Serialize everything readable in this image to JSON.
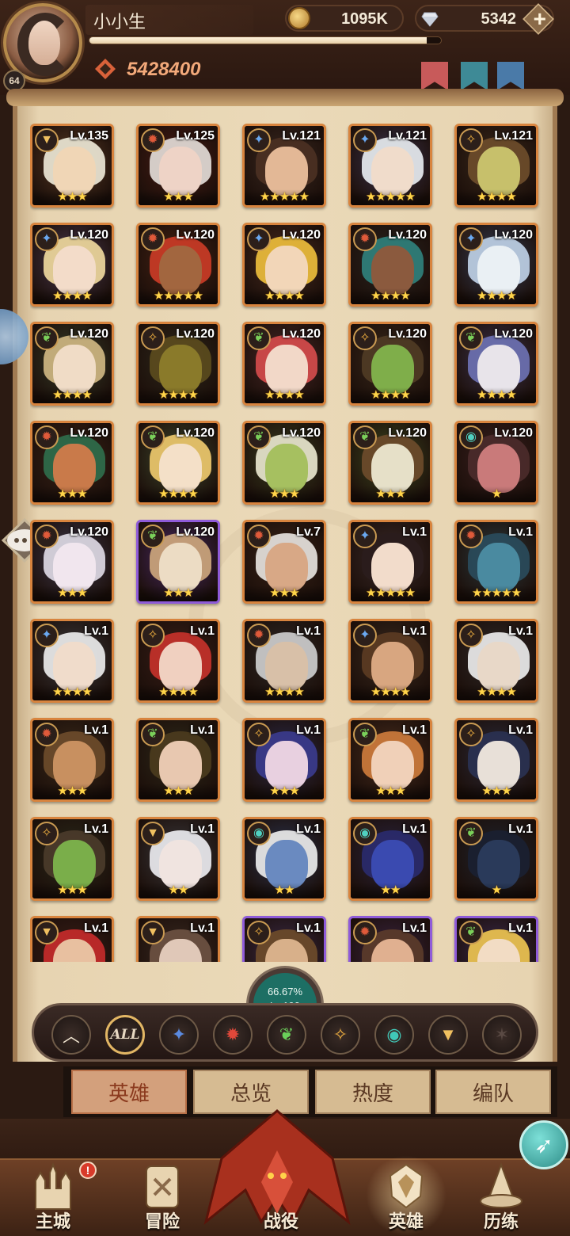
{
  "player": {
    "name": "小小生",
    "level": "64",
    "power": "5428400",
    "xp_progress": 0.96
  },
  "currencies": {
    "gold": "1095K",
    "gems": "5342",
    "gold_icon": "gold-coin-icon",
    "gem_icon": "diamond-icon",
    "plus_icon": "plus-icon"
  },
  "heroes": [
    {
      "level": "Lv.135",
      "faction": "lightbearer",
      "stars": 3,
      "frame": "orange",
      "skin": "#f0d6b6",
      "hair": "#e7e2d0",
      "bg": "#5a3b24"
    },
    {
      "level": "Lv.125",
      "faction": "maulers",
      "stars": 3,
      "frame": "orange",
      "skin": "#eed3c6",
      "hair": "#ddd6d2",
      "bg": "#4a1c14"
    },
    {
      "level": "Lv.121",
      "faction": "wilder_blue",
      "stars": 5,
      "frame": "orange",
      "skin": "#e3b896",
      "hair": "#4a2f22",
      "bg": "#3b2a22"
    },
    {
      "level": "Lv.121",
      "faction": "wilder_blue",
      "stars": 5,
      "frame": "orange",
      "skin": "#f0dccb",
      "hair": "#e2e6ea",
      "bg": "#3c3550"
    },
    {
      "level": "Lv.121",
      "faction": "graveborn_gold",
      "stars": 4,
      "frame": "orange",
      "skin": "#c7c06b",
      "hair": "#6a4b2a",
      "bg": "#3a2a1c"
    },
    {
      "level": "Lv.120",
      "faction": "wilder_blue",
      "stars": 4,
      "frame": "orange",
      "skin": "#f3dcc9",
      "hair": "#e9d39a",
      "bg": "#4a3a52"
    },
    {
      "level": "Lv.120",
      "faction": "maulers",
      "stars": 5,
      "frame": "orange",
      "skin": "#a2663f",
      "hair": "#c53a26",
      "bg": "#4a2414"
    },
    {
      "level": "Lv.120",
      "faction": "wilder_blue",
      "stars": 4,
      "frame": "orange",
      "skin": "#f2d6b8",
      "hair": "#e7b83a",
      "bg": "#4a2c20"
    },
    {
      "level": "Lv.120",
      "faction": "maulers",
      "stars": 4,
      "frame": "orange",
      "skin": "#8b5a3e",
      "hair": "#2f7d78",
      "bg": "#2a2622"
    },
    {
      "level": "Lv.120",
      "faction": "wilder_blue",
      "stars": 4,
      "frame": "orange",
      "skin": "#eaf0f4",
      "hair": "#b9cbe0",
      "bg": "#36405a"
    },
    {
      "level": "Lv.120",
      "faction": "wilder_green",
      "stars": 4,
      "frame": "orange",
      "skin": "#f0dcc6",
      "hair": "#c9b27e",
      "bg": "#36402a"
    },
    {
      "level": "Lv.120",
      "faction": "graveborn_gold",
      "stars": 4,
      "frame": "orange",
      "skin": "#8a7a2a",
      "hair": "#5a4a1e",
      "bg": "#2e2a1c"
    },
    {
      "level": "Lv.120",
      "faction": "wilder_green",
      "stars": 4,
      "frame": "orange",
      "skin": "#f2d8c8",
      "hair": "#d04a4a",
      "bg": "#4a2828"
    },
    {
      "level": "Lv.120",
      "faction": "graveborn_gold",
      "stars": 4,
      "frame": "orange",
      "skin": "#7fae4a",
      "hair": "#4e3a24",
      "bg": "#3a2a1c"
    },
    {
      "level": "Lv.120",
      "faction": "wilder_green",
      "stars": 4,
      "frame": "orange",
      "skin": "#e8e4ea",
      "hair": "#6a6fae",
      "bg": "#3c3450"
    },
    {
      "level": "Lv.120",
      "faction": "maulers",
      "stars": 3,
      "frame": "orange",
      "skin": "#c97a4a",
      "hair": "#2e6a4a",
      "bg": "#3a2418"
    },
    {
      "level": "Lv.120",
      "faction": "wilder_green",
      "stars": 4,
      "frame": "orange",
      "skin": "#f4e0c8",
      "hair": "#e8c46a",
      "bg": "#3e4a2e"
    },
    {
      "level": "Lv.120",
      "faction": "wilder_green",
      "stars": 3,
      "frame": "orange",
      "skin": "#a6c060",
      "hair": "#e3e0c8",
      "bg": "#3a4220"
    },
    {
      "level": "Lv.120",
      "faction": "wilder_green",
      "stars": 3,
      "frame": "orange",
      "skin": "#e6e0c8",
      "hair": "#6a4a2a",
      "bg": "#3e4a20"
    },
    {
      "level": "Lv.120",
      "faction": "dimensional",
      "stars": 1,
      "frame": "orange",
      "skin": "#c97a7a",
      "hair": "#4a2a2a",
      "bg": "#3a2020"
    },
    {
      "level": "Lv.120",
      "faction": "maulers",
      "stars": 3,
      "frame": "orange",
      "skin": "#f1e6ee",
      "hair": "#d8d4de",
      "bg": "#3e3a50"
    },
    {
      "level": "Lv.120",
      "faction": "wilder_green",
      "stars": 3,
      "frame": "purple",
      "skin": "#ecdcc4",
      "hair": "#c8a27a",
      "bg": "#4a2a6a"
    },
    {
      "level": "Lv.7",
      "faction": "maulers",
      "stars": 3,
      "frame": "orange",
      "skin": "#d8a886",
      "hair": "#e0dcd8",
      "bg": "#3a2418"
    },
    {
      "level": "Lv.1",
      "faction": "wilder_blue",
      "stars": 5,
      "frame": "orange",
      "skin": "#f2dccb",
      "hair": "#2a1c1c",
      "bg": "#3a2a2a"
    },
    {
      "level": "Lv.1",
      "faction": "maulers",
      "stars": 5,
      "frame": "orange",
      "skin": "#4a8aa0",
      "hair": "#2a4a5a",
      "bg": "#2a3a3e"
    },
    {
      "level": "Lv.1",
      "faction": "wilder_blue",
      "stars": 4,
      "frame": "orange",
      "skin": "#f0dccb",
      "hair": "#e6e6e6",
      "bg": "#3a3a3e"
    },
    {
      "level": "Lv.1",
      "faction": "graveborn_gold",
      "stars": 4,
      "frame": "orange",
      "skin": "#f0d0c0",
      "hair": "#c0302a",
      "bg": "#3a1e18"
    },
    {
      "level": "Lv.1",
      "faction": "maulers",
      "stars": 4,
      "frame": "orange",
      "skin": "#d8c0a8",
      "hair": "#c8c8c8",
      "bg": "#2e2a28"
    },
    {
      "level": "Lv.1",
      "faction": "wilder_blue",
      "stars": 4,
      "frame": "orange",
      "skin": "#d8a680",
      "hair": "#5a3a22",
      "bg": "#3a2a1e"
    },
    {
      "level": "Lv.1",
      "faction": "graveborn_gold",
      "stars": 4,
      "frame": "orange",
      "skin": "#e8d8c8",
      "hair": "#e6e6e6",
      "bg": "#2e2a2a"
    },
    {
      "level": "Lv.1",
      "faction": "maulers",
      "stars": 3,
      "frame": "orange",
      "skin": "#c89060",
      "hair": "#6a4a2a",
      "bg": "#3a2a1a"
    },
    {
      "level": "Lv.1",
      "faction": "wilder_green",
      "stars": 3,
      "frame": "orange",
      "skin": "#e8c8b0",
      "hair": "#4a3a1e",
      "bg": "#2e2a1a"
    },
    {
      "level": "Lv.1",
      "faction": "graveborn_gold",
      "stars": 3,
      "frame": "orange",
      "skin": "#e8d0e0",
      "hair": "#3a3a8a",
      "bg": "#2a2a4a"
    },
    {
      "level": "Lv.1",
      "faction": "wilder_green",
      "stars": 3,
      "frame": "orange",
      "skin": "#f0d0b8",
      "hair": "#c8783a",
      "bg": "#4a2e1e"
    },
    {
      "level": "Lv.1",
      "faction": "graveborn_gold",
      "stars": 3,
      "frame": "orange",
      "skin": "#e8e0d8",
      "hair": "#2a3050",
      "bg": "#2a2a3a"
    },
    {
      "level": "Lv.1",
      "faction": "graveborn_gold",
      "stars": 3,
      "frame": "orange",
      "skin": "#7aae4a",
      "hair": "#4a3a2a",
      "bg": "#2a2a1a"
    },
    {
      "level": "Lv.1",
      "faction": "lightbearer",
      "stars": 2,
      "frame": "orange",
      "skin": "#f0e4e0",
      "hair": "#e6e6ea",
      "bg": "#3a3a3e"
    },
    {
      "level": "Lv.1",
      "faction": "dimensional",
      "stars": 2,
      "frame": "orange",
      "skin": "#6a8ac0",
      "hair": "#e6e6e6",
      "bg": "#2a3450"
    },
    {
      "level": "Lv.1",
      "faction": "dimensional",
      "stars": 2,
      "frame": "orange",
      "skin": "#3a4ab0",
      "hair": "#2a2a6a",
      "bg": "#2a2440"
    },
    {
      "level": "Lv.1",
      "faction": "wilder_green",
      "stars": 1,
      "frame": "orange",
      "skin": "#2a3a5a",
      "hair": "#1a2030",
      "bg": "#1e242e"
    },
    {
      "level": "Lv.1",
      "faction": "lightbearer",
      "stars": 0,
      "frame": "orange",
      "skin": "#e8c0a0",
      "hair": "#c02a2a",
      "bg": "#3a1e18"
    },
    {
      "level": "Lv.1",
      "faction": "lightbearer",
      "stars": 0,
      "frame": "orange",
      "skin": "#e0c8b8",
      "hair": "#6a5040",
      "bg": "#3a2a22"
    },
    {
      "level": "Lv.1",
      "faction": "graveborn_gold",
      "stars": 0,
      "frame": "purple",
      "skin": "#d8b08a",
      "hair": "#6a4a2a",
      "bg": "#3a2a4a"
    },
    {
      "level": "Lv.1",
      "faction": "maulers",
      "stars": 0,
      "frame": "purple",
      "skin": "#e0b090",
      "hair": "#5a3a2a",
      "bg": "#3a2444"
    },
    {
      "level": "Lv.1",
      "faction": "wilder_green",
      "stars": 0,
      "frame": "purple",
      "skin": "#f2dcc4",
      "hair": "#e8c050",
      "bg": "#3a2a50"
    }
  ],
  "faction_icons": {
    "lightbearer": {
      "glyph": "▼",
      "color": "#f0c060"
    },
    "maulers": {
      "glyph": "✹",
      "color": "#e05a3a"
    },
    "wilder_blue": {
      "glyph": "✦",
      "color": "#6aa8f0"
    },
    "wilder_green": {
      "glyph": "❦",
      "color": "#7ad05a"
    },
    "graveborn_gold": {
      "glyph": "✧",
      "color": "#f0b040"
    },
    "dimensional": {
      "glyph": "◉",
      "color": "#50d0c0"
    }
  },
  "collection": {
    "percent": "66.67%",
    "level": "Lv.190"
  },
  "filters": [
    {
      "name": "collapse",
      "label": "︿",
      "color": "#f0e4d0"
    },
    {
      "name": "all",
      "label": "ALL",
      "color": "#e7d8c2"
    },
    {
      "name": "lightbearers",
      "label": "✦",
      "color": "#5a8ae0"
    },
    {
      "name": "maulers",
      "label": "✹",
      "color": "#e0483a"
    },
    {
      "name": "wilders",
      "label": "❦",
      "color": "#6ad05a"
    },
    {
      "name": "graveborn",
      "label": "✧",
      "color": "#f0b040"
    },
    {
      "name": "celestial",
      "label": "◉",
      "color": "#40c8b8"
    },
    {
      "name": "hypogean",
      "label": "▼",
      "color": "#f0c060"
    },
    {
      "name": "dimensional",
      "label": "✶",
      "color": "#5a4a44"
    }
  ],
  "tabs": [
    "英雄",
    "总览",
    "热度",
    "编队"
  ],
  "nav": [
    {
      "label": "主城",
      "icon": "castle-icon"
    },
    {
      "label": "冒险",
      "icon": "scroll-map-icon"
    },
    {
      "label": "战役",
      "icon": "dragon-icon"
    },
    {
      "label": "英雄",
      "icon": "hero-helmet-icon"
    },
    {
      "label": "历练",
      "icon": "wizard-hat-icon"
    }
  ],
  "alert_badge": "!"
}
